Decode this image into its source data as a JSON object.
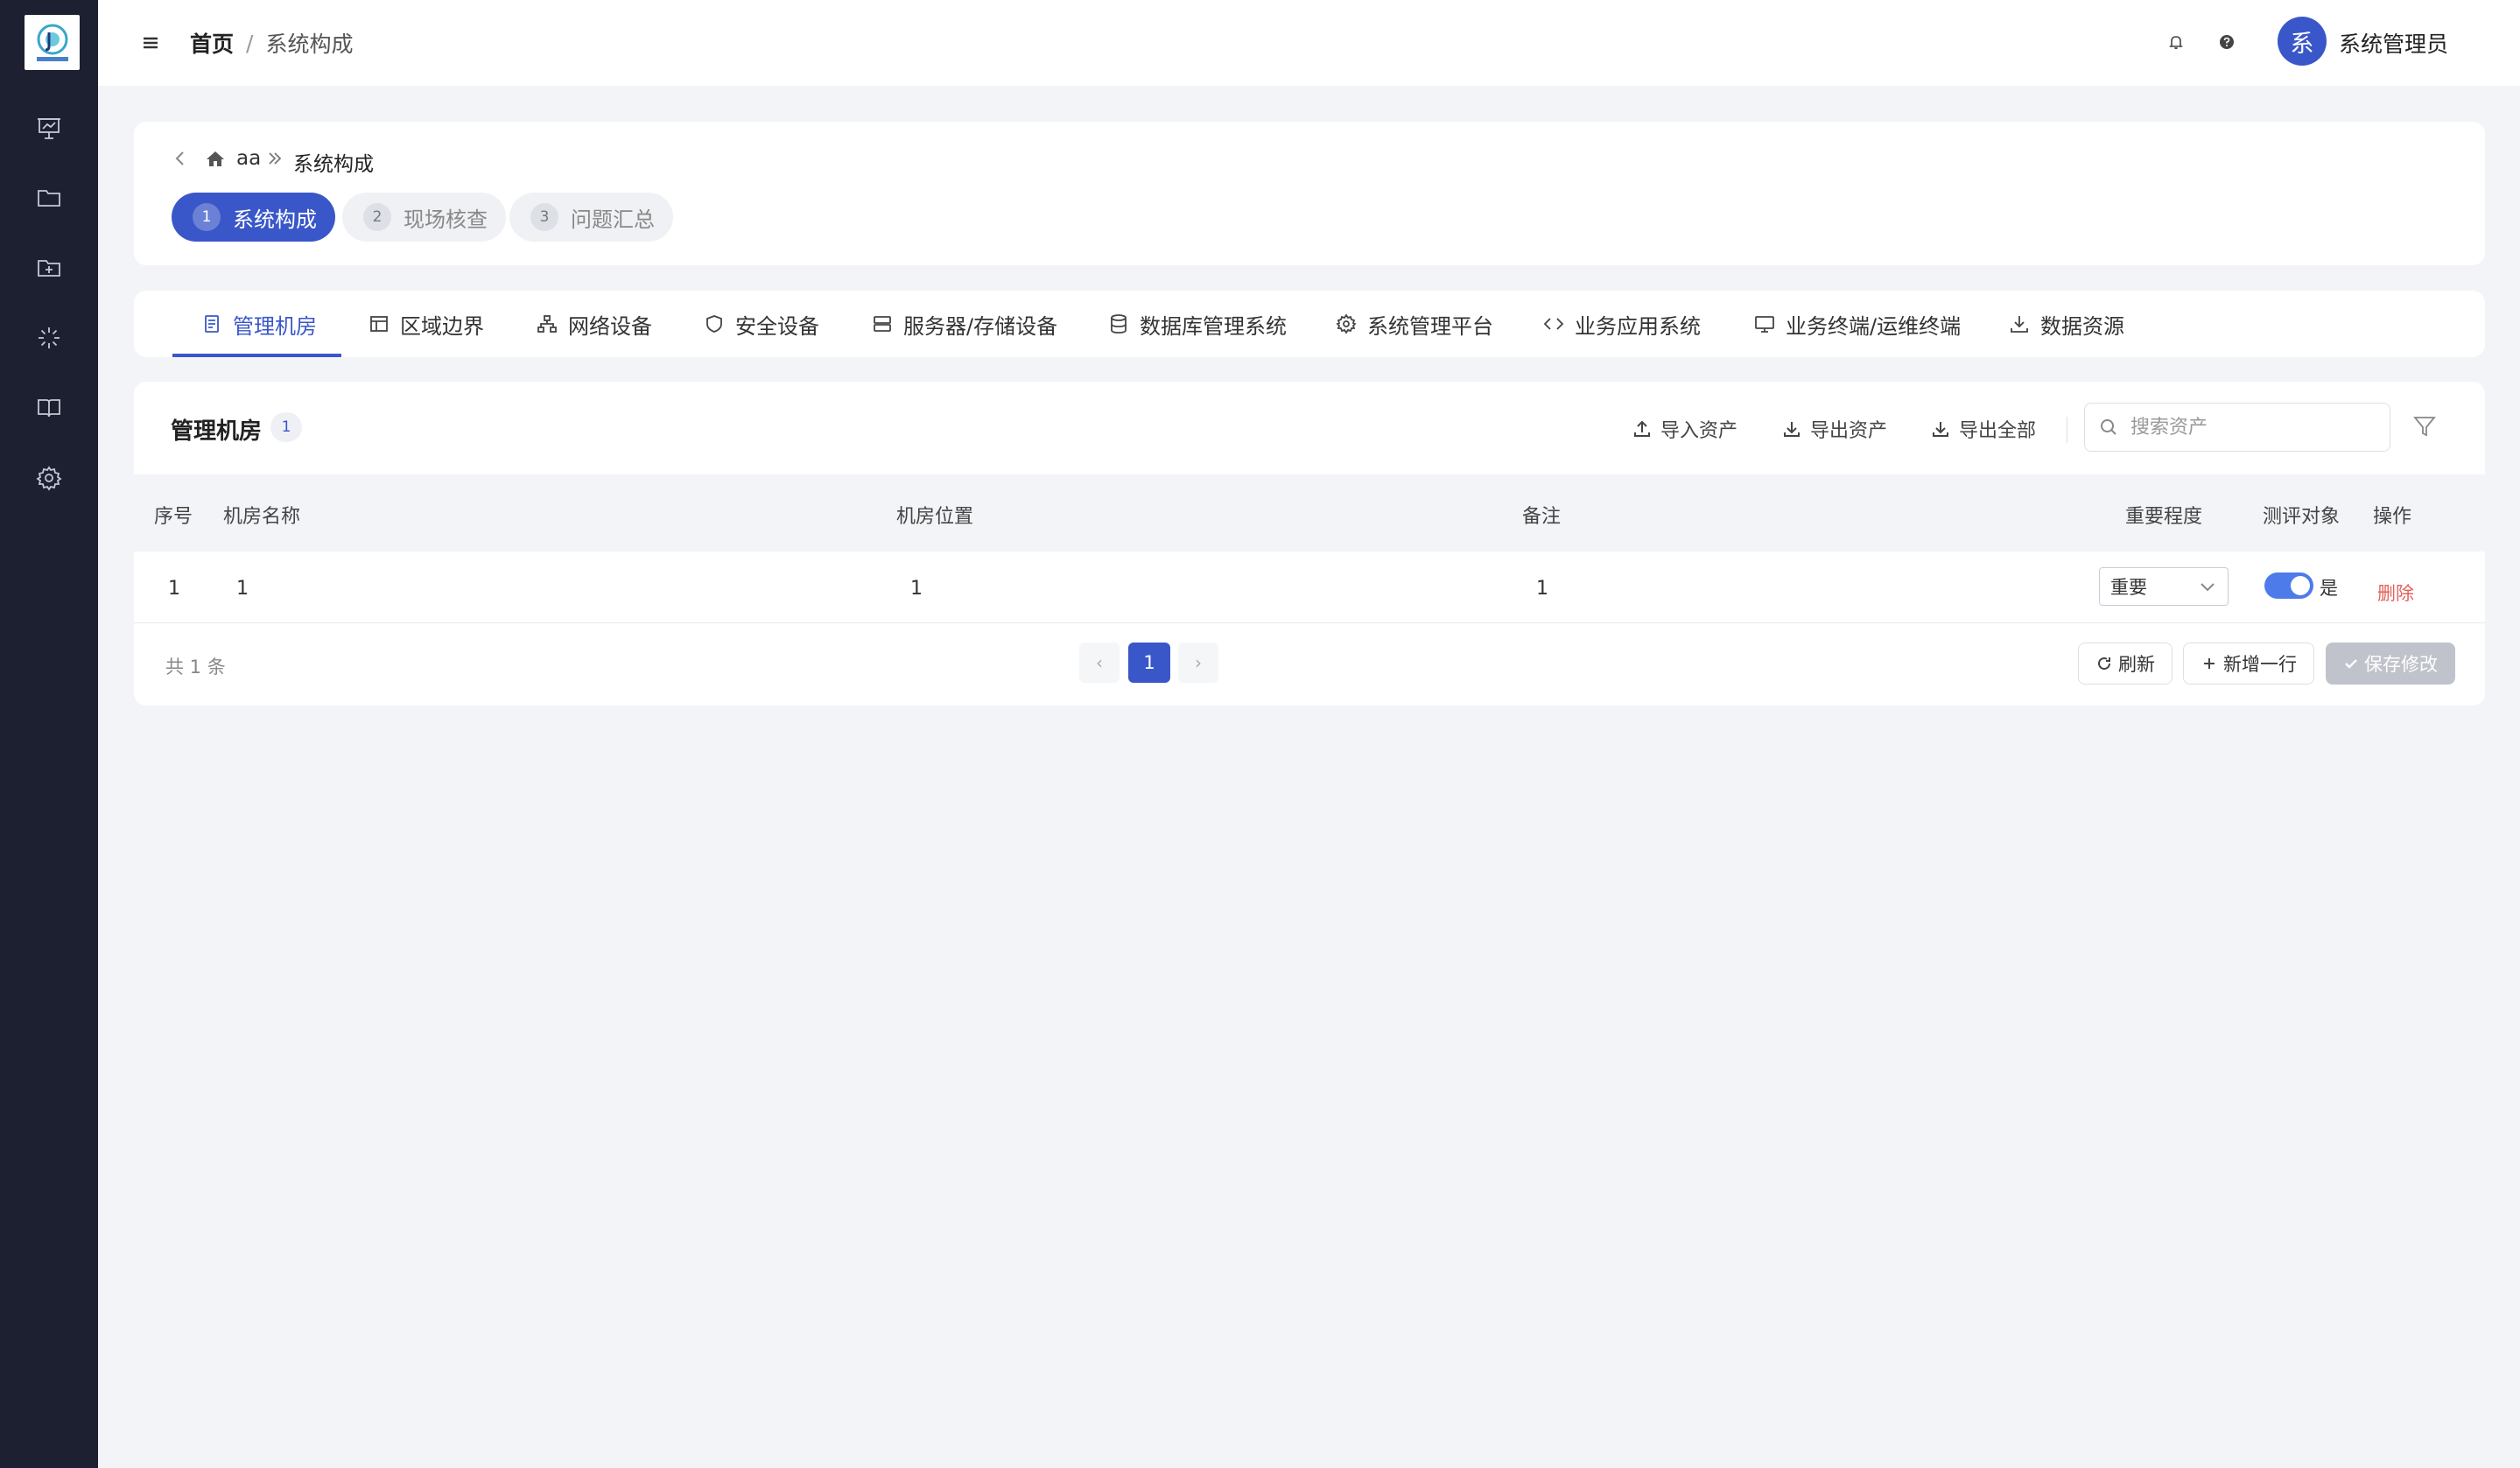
{
  "header": {
    "breadcrumb_home": "首页",
    "breadcrumb_sep": "/",
    "breadcrumb_current": "系统构成",
    "user_avatar_char": "系",
    "user_name": "系统管理员"
  },
  "subnav": {
    "parent": "aa",
    "current": "系统构成"
  },
  "steps": [
    {
      "num": "1",
      "label": "系统构成"
    },
    {
      "num": "2",
      "label": "现场核查"
    },
    {
      "num": "3",
      "label": "问题汇总"
    }
  ],
  "tabs": [
    {
      "label": "管理机房",
      "icon": "document-icon"
    },
    {
      "label": "区域边界",
      "icon": "layout-icon"
    },
    {
      "label": "网络设备",
      "icon": "network-icon"
    },
    {
      "label": "安全设备",
      "icon": "shield-icon"
    },
    {
      "label": "服务器/存储设备",
      "icon": "server-icon"
    },
    {
      "label": "数据库管理系统",
      "icon": "database-icon"
    },
    {
      "label": "系统管理平台",
      "icon": "gear-icon"
    },
    {
      "label": "业务应用系统",
      "icon": "code-icon"
    },
    {
      "label": "业务终端/运维终端",
      "icon": "monitor-icon"
    },
    {
      "label": "数据资源",
      "icon": "download-icon"
    }
  ],
  "table": {
    "title": "管理机房",
    "count": "1",
    "actions": {
      "import": "导入资产",
      "export": "导出资产",
      "export_all": "导出全部"
    },
    "search_placeholder": "搜索资产",
    "columns": {
      "index": "序号",
      "name": "机房名称",
      "location": "机房位置",
      "remark": "备注",
      "importance": "重要程度",
      "target": "测评对象",
      "ops": "操作"
    },
    "rows": [
      {
        "index": "1",
        "name": "1",
        "location": "1",
        "remark": "1",
        "importance": "重要",
        "target_on": true,
        "target_label": "是",
        "delete": "删除"
      }
    ],
    "total": "共 1 条",
    "current_page": "1",
    "prev": "‹",
    "next": "›",
    "refresh": "刷新",
    "add_row": "新增一行",
    "save": "保存修改"
  },
  "colors": {
    "sidebar": "#1c2030",
    "accent": "#3a57c9",
    "danger": "#e0615c",
    "toggle": "#4d7bea"
  }
}
